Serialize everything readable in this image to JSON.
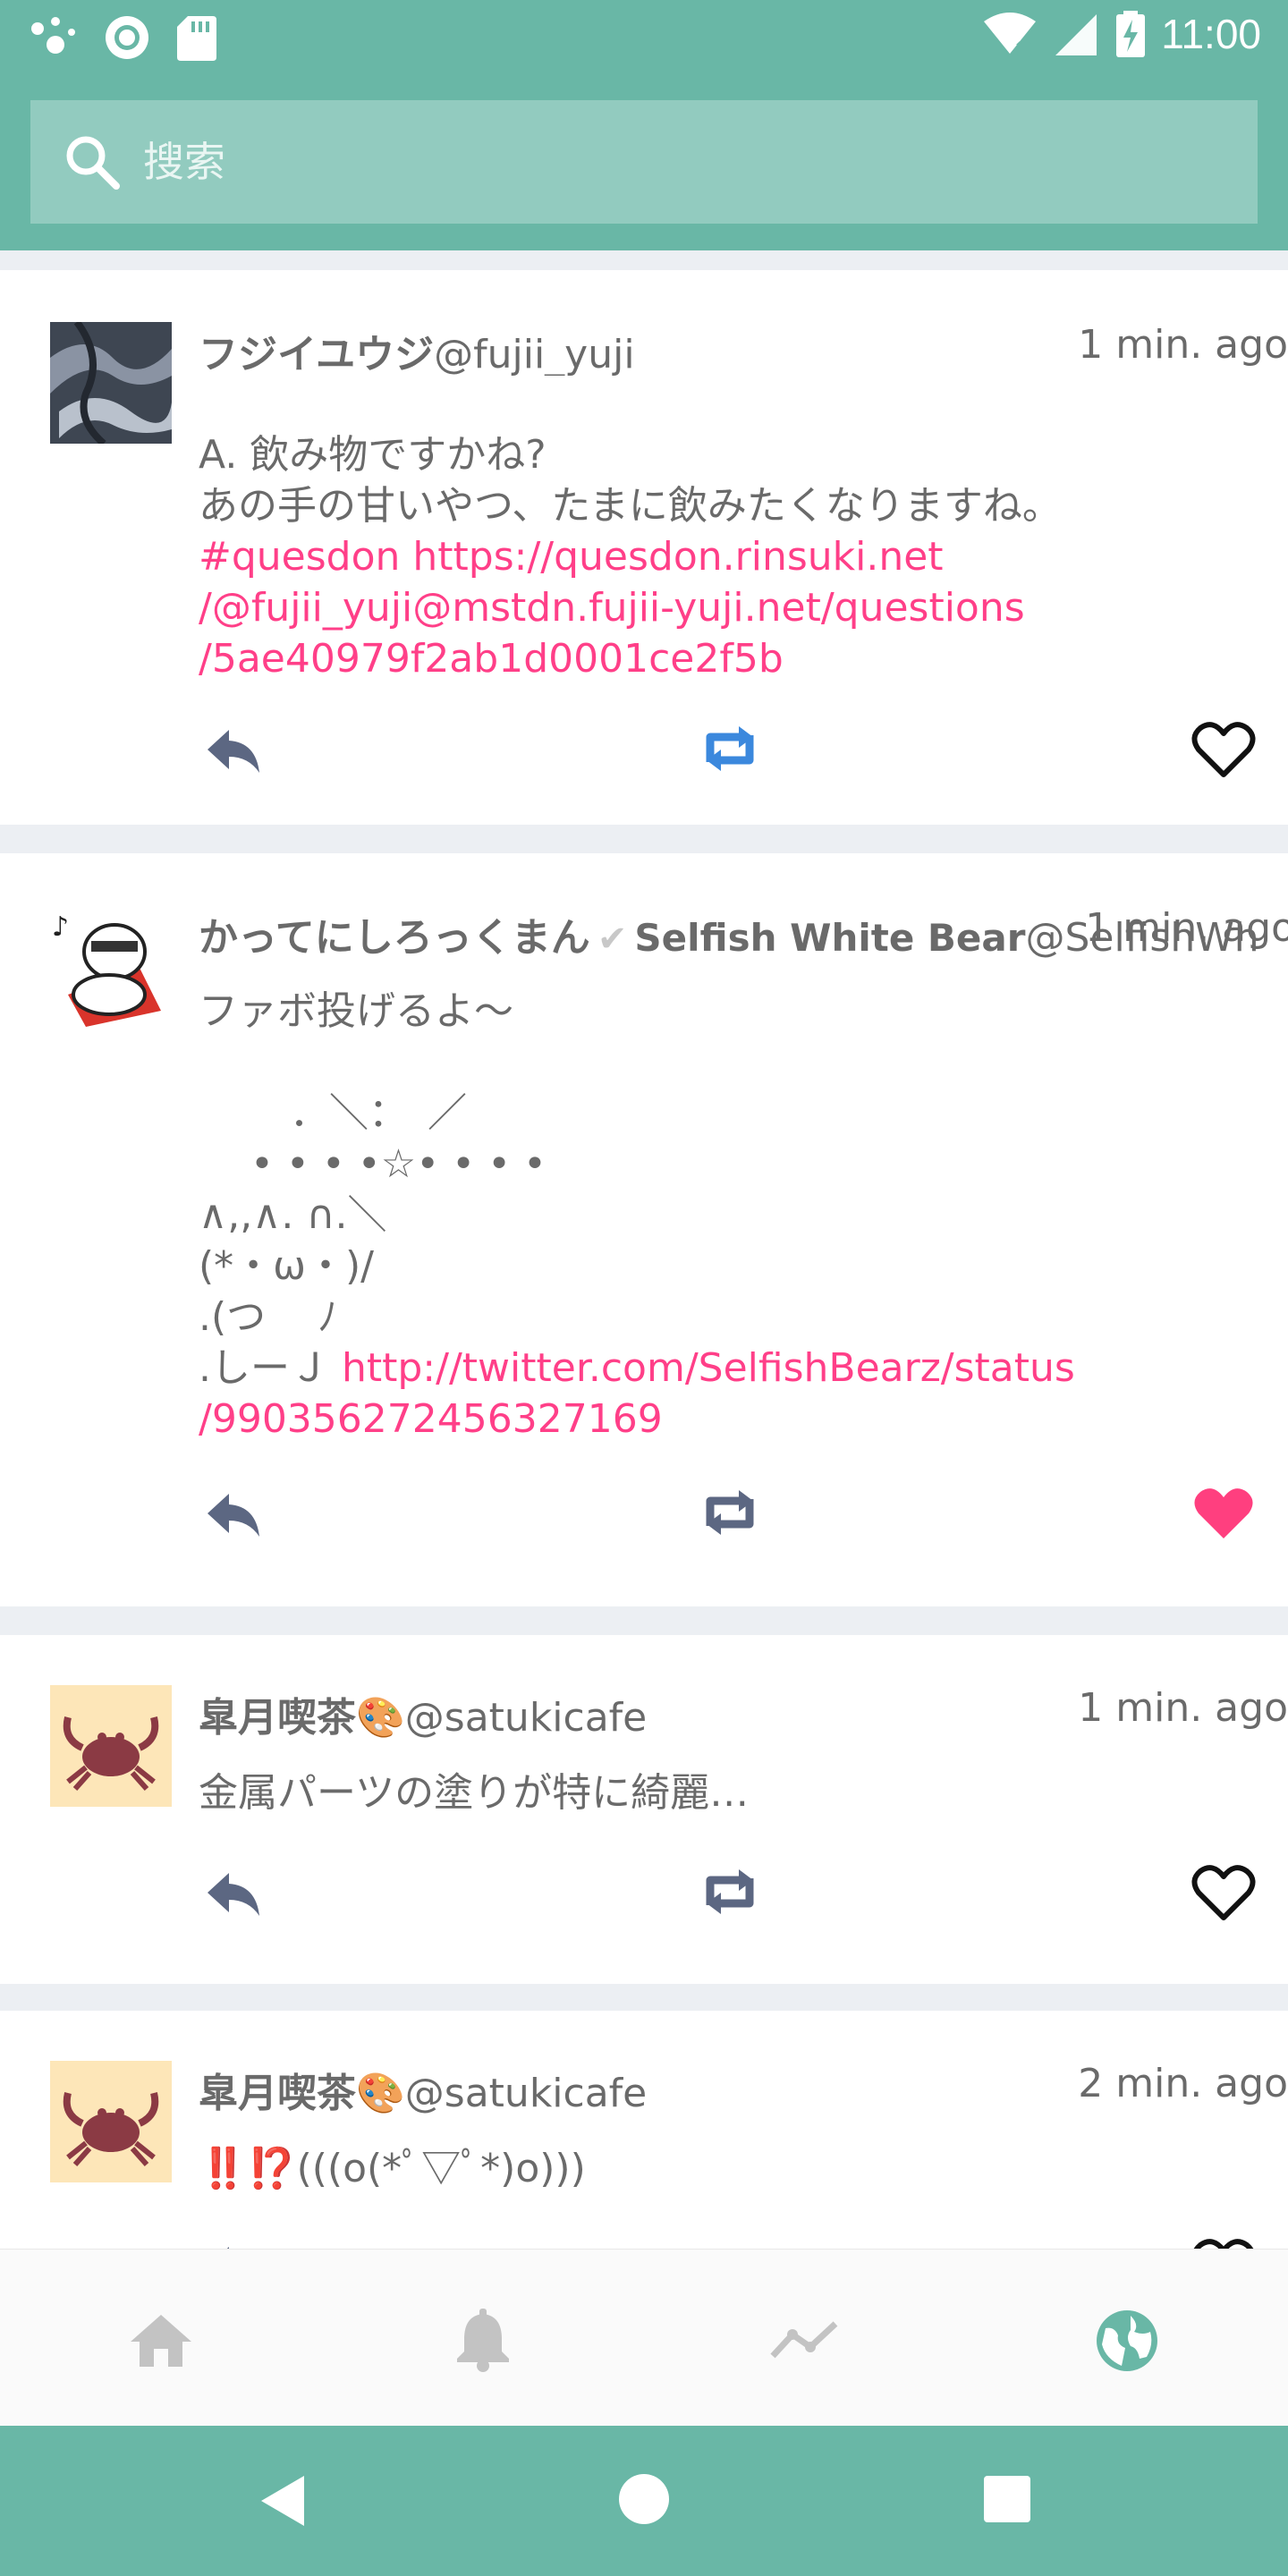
{
  "status": {
    "time": "11:00"
  },
  "search": {
    "placeholder": "搜索"
  },
  "posts": [
    {
      "display_name": "フジイユウジ",
      "acct": "@fujii_yuji",
      "time": "1 min. ago",
      "text": "A. 飲み物ですかね?\nあの手の甘いやつ、たまに飲みたくなりますね。",
      "link_text": "#quesdon https://quesdon.rinsuki.net\n/@fujii_yuji@mstdn.fujii-yuji.net/questions\n/5ae40979f2ab1d0001ce2f5b",
      "boosted": true,
      "favourited": false
    },
    {
      "display_name": "かってにしろっくまん",
      "display_name_extra": "Selfish White Bear",
      "acct": "@SelfishWh",
      "time": "1 min. ago",
      "text": "ファボ投げるよ〜\n\n　　 ．＼：　／\n　 • • • •☆• • • •\n∧,,∧. ∩.＼\n(*・ω・)/\n.(つ　 ﾉ\n.しーＪ ",
      "link_text": "http://twitter.com/SelfishBearz/status\n/990356272456327169",
      "boosted": false,
      "favourited": true
    },
    {
      "display_name": "皐月喫茶🎨",
      "acct": "@satukicafe",
      "time": "1 min. ago",
      "text": "金属パーツの塗りが特に綺麗…",
      "boosted": false,
      "favourited": false
    },
    {
      "display_name": "皐月喫茶🎨",
      "acct": "@satukicafe",
      "time": "2 min. ago",
      "text": "‼️⁉️(((o(*ﾟ▽ﾟ*)o)))",
      "boosted": false,
      "favourited": false
    }
  ],
  "colors": {
    "accent": "#69b7a6",
    "link": "#ff3f88",
    "boost_active": "#3b88dd",
    "icon": "#5c6782",
    "favourite": "#ff3f7f"
  },
  "bottom_nav": [
    "home-icon",
    "notifications-icon",
    "trending-icon",
    "public-icon"
  ]
}
